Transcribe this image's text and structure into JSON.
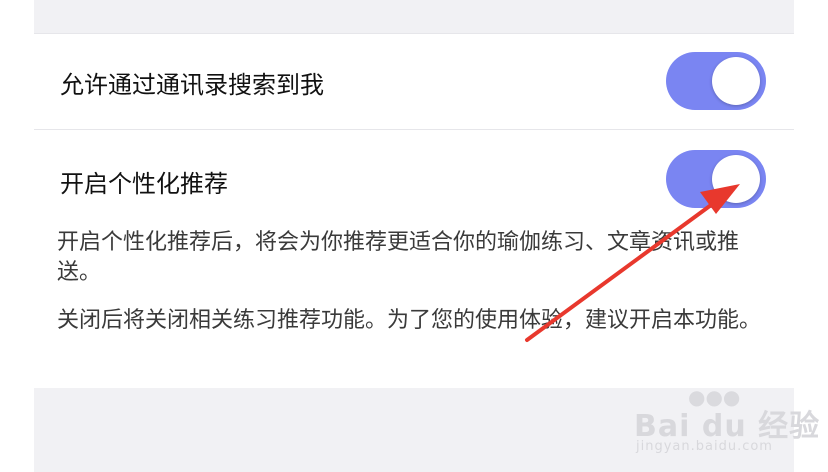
{
  "settings": {
    "contacts_search": {
      "label": "允许通过通讯录搜索到我",
      "enabled": true
    },
    "personalized": {
      "label": "开启个性化推荐",
      "enabled": true,
      "description_1": "开启个性化推荐后，将会为你推荐更适合你的瑜伽练习、文章资讯或推送。",
      "description_2": "关闭后将关闭相关练习推荐功能。为了您的使用体验，建议开启本功能。"
    }
  },
  "colors": {
    "toggle_on": "#7a85f2",
    "arrow": "#e8382d",
    "page_gray": "#f1f1f4"
  },
  "watermark": {
    "brand": "Bai du 经验",
    "url": "jingyan.baidu.com"
  }
}
